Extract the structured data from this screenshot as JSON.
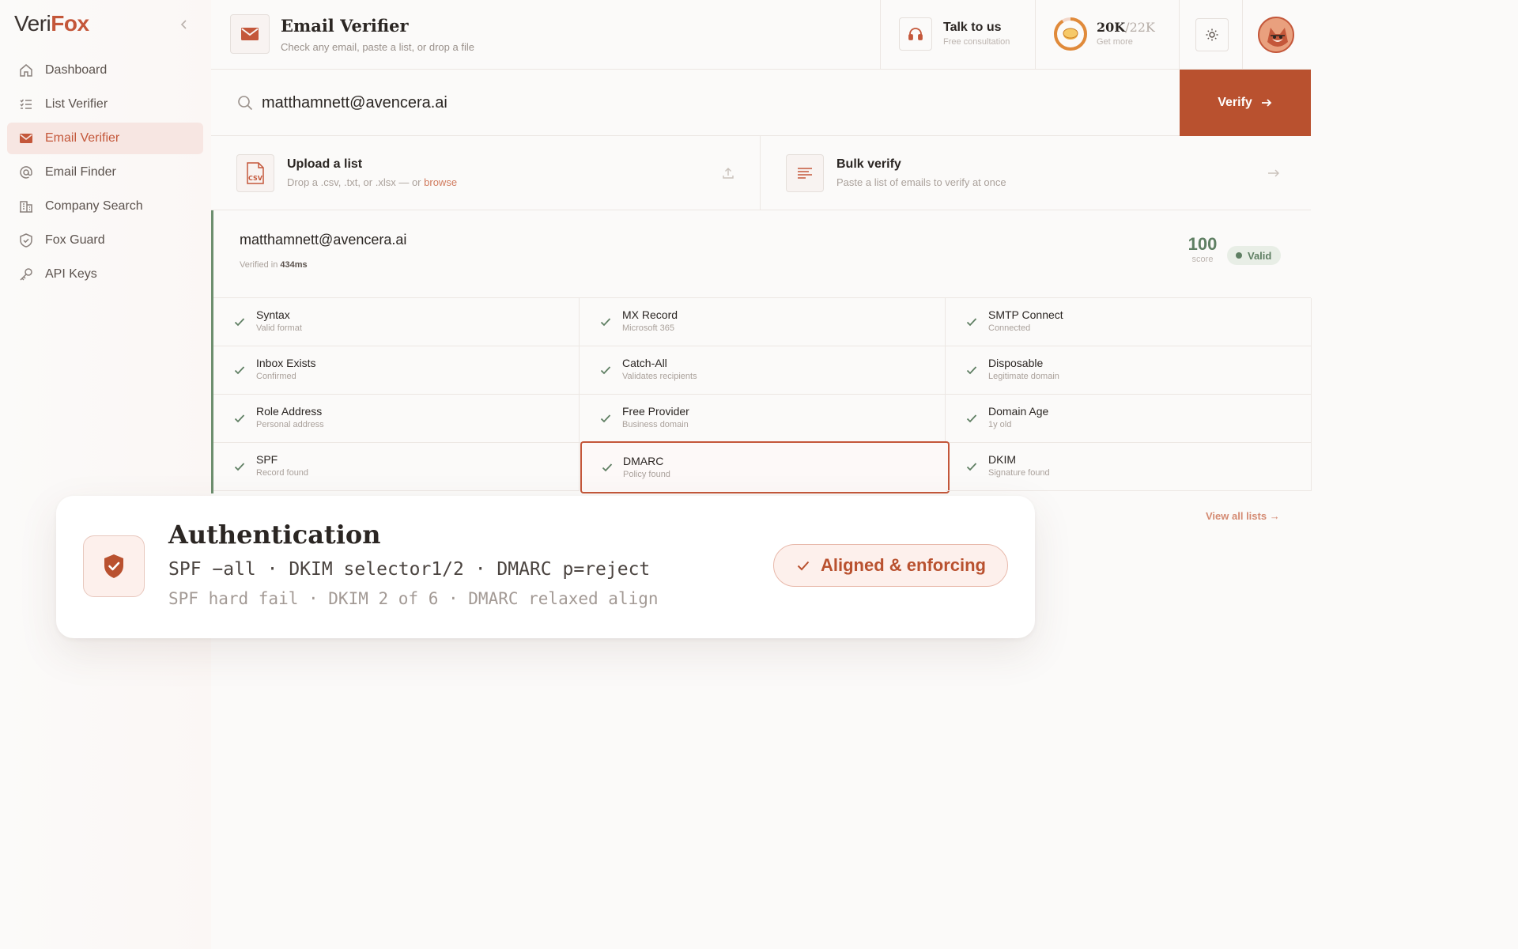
{
  "brand": {
    "part1": "Veri",
    "part2": "Fox"
  },
  "sidebar": {
    "items": [
      {
        "label": "Dashboard",
        "icon": "home-icon"
      },
      {
        "label": "List Verifier",
        "icon": "list-icon"
      },
      {
        "label": "Email Verifier",
        "icon": "mail-icon",
        "active": true
      },
      {
        "label": "Email Finder",
        "icon": "at-icon"
      },
      {
        "label": "Company Search",
        "icon": "building-icon"
      },
      {
        "label": "Fox Guard",
        "icon": "shield-icon"
      },
      {
        "label": "API Keys",
        "icon": "key-icon"
      }
    ]
  },
  "header": {
    "title": "Email Verifier",
    "subtitle": "Check any email, paste a list, or drop a file",
    "talk_title": "Talk to us",
    "talk_sub": "Free consultation",
    "credits_used": "20K",
    "credits_total": "/22K",
    "credits_sub": "Get more"
  },
  "search": {
    "value": "matthamnett@avencera.ai",
    "verify_label": "Verify"
  },
  "actions": {
    "upload_title": "Upload a list",
    "upload_sub": "Drop a .csv, .txt, or .xlsx — or",
    "upload_link": "browse",
    "csv_label": "CSV",
    "bulk_title": "Bulk verify",
    "bulk_sub": "Paste a list of emails to verify at once"
  },
  "result": {
    "email": "matthamnett@avencera.ai",
    "time_prefix": "Verified in",
    "time_value": "434ms",
    "score": "100",
    "score_label": "score",
    "status": "Valid",
    "checks": [
      {
        "label": "Syntax",
        "sub": "Valid format"
      },
      {
        "label": "MX Record",
        "sub": "Microsoft 365"
      },
      {
        "label": "SMTP Connect",
        "sub": "Connected"
      },
      {
        "label": "Inbox Exists",
        "sub": "Confirmed"
      },
      {
        "label": "Catch-All",
        "sub": "Validates recipients"
      },
      {
        "label": "Disposable",
        "sub": "Legitimate domain"
      },
      {
        "label": "Role Address",
        "sub": "Personal address"
      },
      {
        "label": "Free Provider",
        "sub": "Business domain"
      },
      {
        "label": "Domain Age",
        "sub": "1y old"
      },
      {
        "label": "SPF",
        "sub": "Record found"
      },
      {
        "label": "DMARC",
        "sub": "Policy found"
      },
      {
        "label": "DKIM",
        "sub": "Signature found"
      }
    ]
  },
  "view_all": "View all lists",
  "callout": {
    "title": "Authentication",
    "line1": "SPF −all · DKIM selector1/2 · DMARC p=reject",
    "line2": "SPF hard fail · DKIM 2 of 6 · DMARC relaxed align",
    "badge": "Aligned & enforcing"
  },
  "colors": {
    "accent": "#c4573a",
    "button": "#b9512f",
    "valid": "#5f7f63"
  }
}
